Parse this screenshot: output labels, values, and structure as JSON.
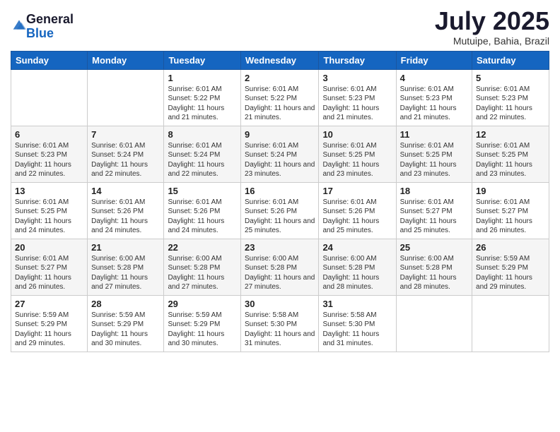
{
  "logo": {
    "general": "General",
    "blue": "Blue"
  },
  "title": "July 2025",
  "location": "Mutuipe, Bahia, Brazil",
  "days_of_week": [
    "Sunday",
    "Monday",
    "Tuesday",
    "Wednesday",
    "Thursday",
    "Friday",
    "Saturday"
  ],
  "weeks": [
    [
      {
        "day": "",
        "info": ""
      },
      {
        "day": "",
        "info": ""
      },
      {
        "day": "1",
        "info": "Sunrise: 6:01 AM\nSunset: 5:22 PM\nDaylight: 11 hours and 21 minutes."
      },
      {
        "day": "2",
        "info": "Sunrise: 6:01 AM\nSunset: 5:22 PM\nDaylight: 11 hours and 21 minutes."
      },
      {
        "day": "3",
        "info": "Sunrise: 6:01 AM\nSunset: 5:23 PM\nDaylight: 11 hours and 21 minutes."
      },
      {
        "day": "4",
        "info": "Sunrise: 6:01 AM\nSunset: 5:23 PM\nDaylight: 11 hours and 21 minutes."
      },
      {
        "day": "5",
        "info": "Sunrise: 6:01 AM\nSunset: 5:23 PM\nDaylight: 11 hours and 22 minutes."
      }
    ],
    [
      {
        "day": "6",
        "info": "Sunrise: 6:01 AM\nSunset: 5:23 PM\nDaylight: 11 hours and 22 minutes."
      },
      {
        "day": "7",
        "info": "Sunrise: 6:01 AM\nSunset: 5:24 PM\nDaylight: 11 hours and 22 minutes."
      },
      {
        "day": "8",
        "info": "Sunrise: 6:01 AM\nSunset: 5:24 PM\nDaylight: 11 hours and 22 minutes."
      },
      {
        "day": "9",
        "info": "Sunrise: 6:01 AM\nSunset: 5:24 PM\nDaylight: 11 hours and 23 minutes."
      },
      {
        "day": "10",
        "info": "Sunrise: 6:01 AM\nSunset: 5:25 PM\nDaylight: 11 hours and 23 minutes."
      },
      {
        "day": "11",
        "info": "Sunrise: 6:01 AM\nSunset: 5:25 PM\nDaylight: 11 hours and 23 minutes."
      },
      {
        "day": "12",
        "info": "Sunrise: 6:01 AM\nSunset: 5:25 PM\nDaylight: 11 hours and 23 minutes."
      }
    ],
    [
      {
        "day": "13",
        "info": "Sunrise: 6:01 AM\nSunset: 5:25 PM\nDaylight: 11 hours and 24 minutes."
      },
      {
        "day": "14",
        "info": "Sunrise: 6:01 AM\nSunset: 5:26 PM\nDaylight: 11 hours and 24 minutes."
      },
      {
        "day": "15",
        "info": "Sunrise: 6:01 AM\nSunset: 5:26 PM\nDaylight: 11 hours and 24 minutes."
      },
      {
        "day": "16",
        "info": "Sunrise: 6:01 AM\nSunset: 5:26 PM\nDaylight: 11 hours and 25 minutes."
      },
      {
        "day": "17",
        "info": "Sunrise: 6:01 AM\nSunset: 5:26 PM\nDaylight: 11 hours and 25 minutes."
      },
      {
        "day": "18",
        "info": "Sunrise: 6:01 AM\nSunset: 5:27 PM\nDaylight: 11 hours and 25 minutes."
      },
      {
        "day": "19",
        "info": "Sunrise: 6:01 AM\nSunset: 5:27 PM\nDaylight: 11 hours and 26 minutes."
      }
    ],
    [
      {
        "day": "20",
        "info": "Sunrise: 6:01 AM\nSunset: 5:27 PM\nDaylight: 11 hours and 26 minutes."
      },
      {
        "day": "21",
        "info": "Sunrise: 6:00 AM\nSunset: 5:28 PM\nDaylight: 11 hours and 27 minutes."
      },
      {
        "day": "22",
        "info": "Sunrise: 6:00 AM\nSunset: 5:28 PM\nDaylight: 11 hours and 27 minutes."
      },
      {
        "day": "23",
        "info": "Sunrise: 6:00 AM\nSunset: 5:28 PM\nDaylight: 11 hours and 27 minutes."
      },
      {
        "day": "24",
        "info": "Sunrise: 6:00 AM\nSunset: 5:28 PM\nDaylight: 11 hours and 28 minutes."
      },
      {
        "day": "25",
        "info": "Sunrise: 6:00 AM\nSunset: 5:28 PM\nDaylight: 11 hours and 28 minutes."
      },
      {
        "day": "26",
        "info": "Sunrise: 5:59 AM\nSunset: 5:29 PM\nDaylight: 11 hours and 29 minutes."
      }
    ],
    [
      {
        "day": "27",
        "info": "Sunrise: 5:59 AM\nSunset: 5:29 PM\nDaylight: 11 hours and 29 minutes."
      },
      {
        "day": "28",
        "info": "Sunrise: 5:59 AM\nSunset: 5:29 PM\nDaylight: 11 hours and 30 minutes."
      },
      {
        "day": "29",
        "info": "Sunrise: 5:59 AM\nSunset: 5:29 PM\nDaylight: 11 hours and 30 minutes."
      },
      {
        "day": "30",
        "info": "Sunrise: 5:58 AM\nSunset: 5:30 PM\nDaylight: 11 hours and 31 minutes."
      },
      {
        "day": "31",
        "info": "Sunrise: 5:58 AM\nSunset: 5:30 PM\nDaylight: 11 hours and 31 minutes."
      },
      {
        "day": "",
        "info": ""
      },
      {
        "day": "",
        "info": ""
      }
    ]
  ]
}
